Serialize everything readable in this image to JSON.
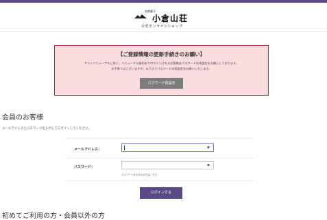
{
  "header": {
    "logo_small": "名物菓子",
    "logo_main": "小倉山荘",
    "logo_sub": "公式オンラインショップ"
  },
  "notice": {
    "title": "【ご登録情報の更新手続きのお願い】",
    "text_line1": "サイトリニューアルに伴い、リニューアル後初めてログインされるお客様はパスワードの再設定をお願いしております。",
    "text_line2": "お手数ではございますが、以下よりパスワードの再設定をお願いいたします。",
    "button_label": "パスワード再設定"
  },
  "member": {
    "title": "会員のお客様",
    "description": "メールアドレスとパスワードを入力してログインしてください。"
  },
  "form": {
    "email_label": "メールアドレス：",
    "email_value": "",
    "password_label": "パスワード：",
    "password_value": "",
    "password_hint": "パスワードをお忘れの方はこちら",
    "key_icon": "key-icon"
  },
  "login": {
    "button_label": "ログインする"
  },
  "section2": {
    "title": "初めてご利用の方・会員以外の方"
  },
  "colors": {
    "accent": "#5b4a87",
    "notice_bg": "#fbdde0",
    "notice_border": "#a8303b"
  }
}
